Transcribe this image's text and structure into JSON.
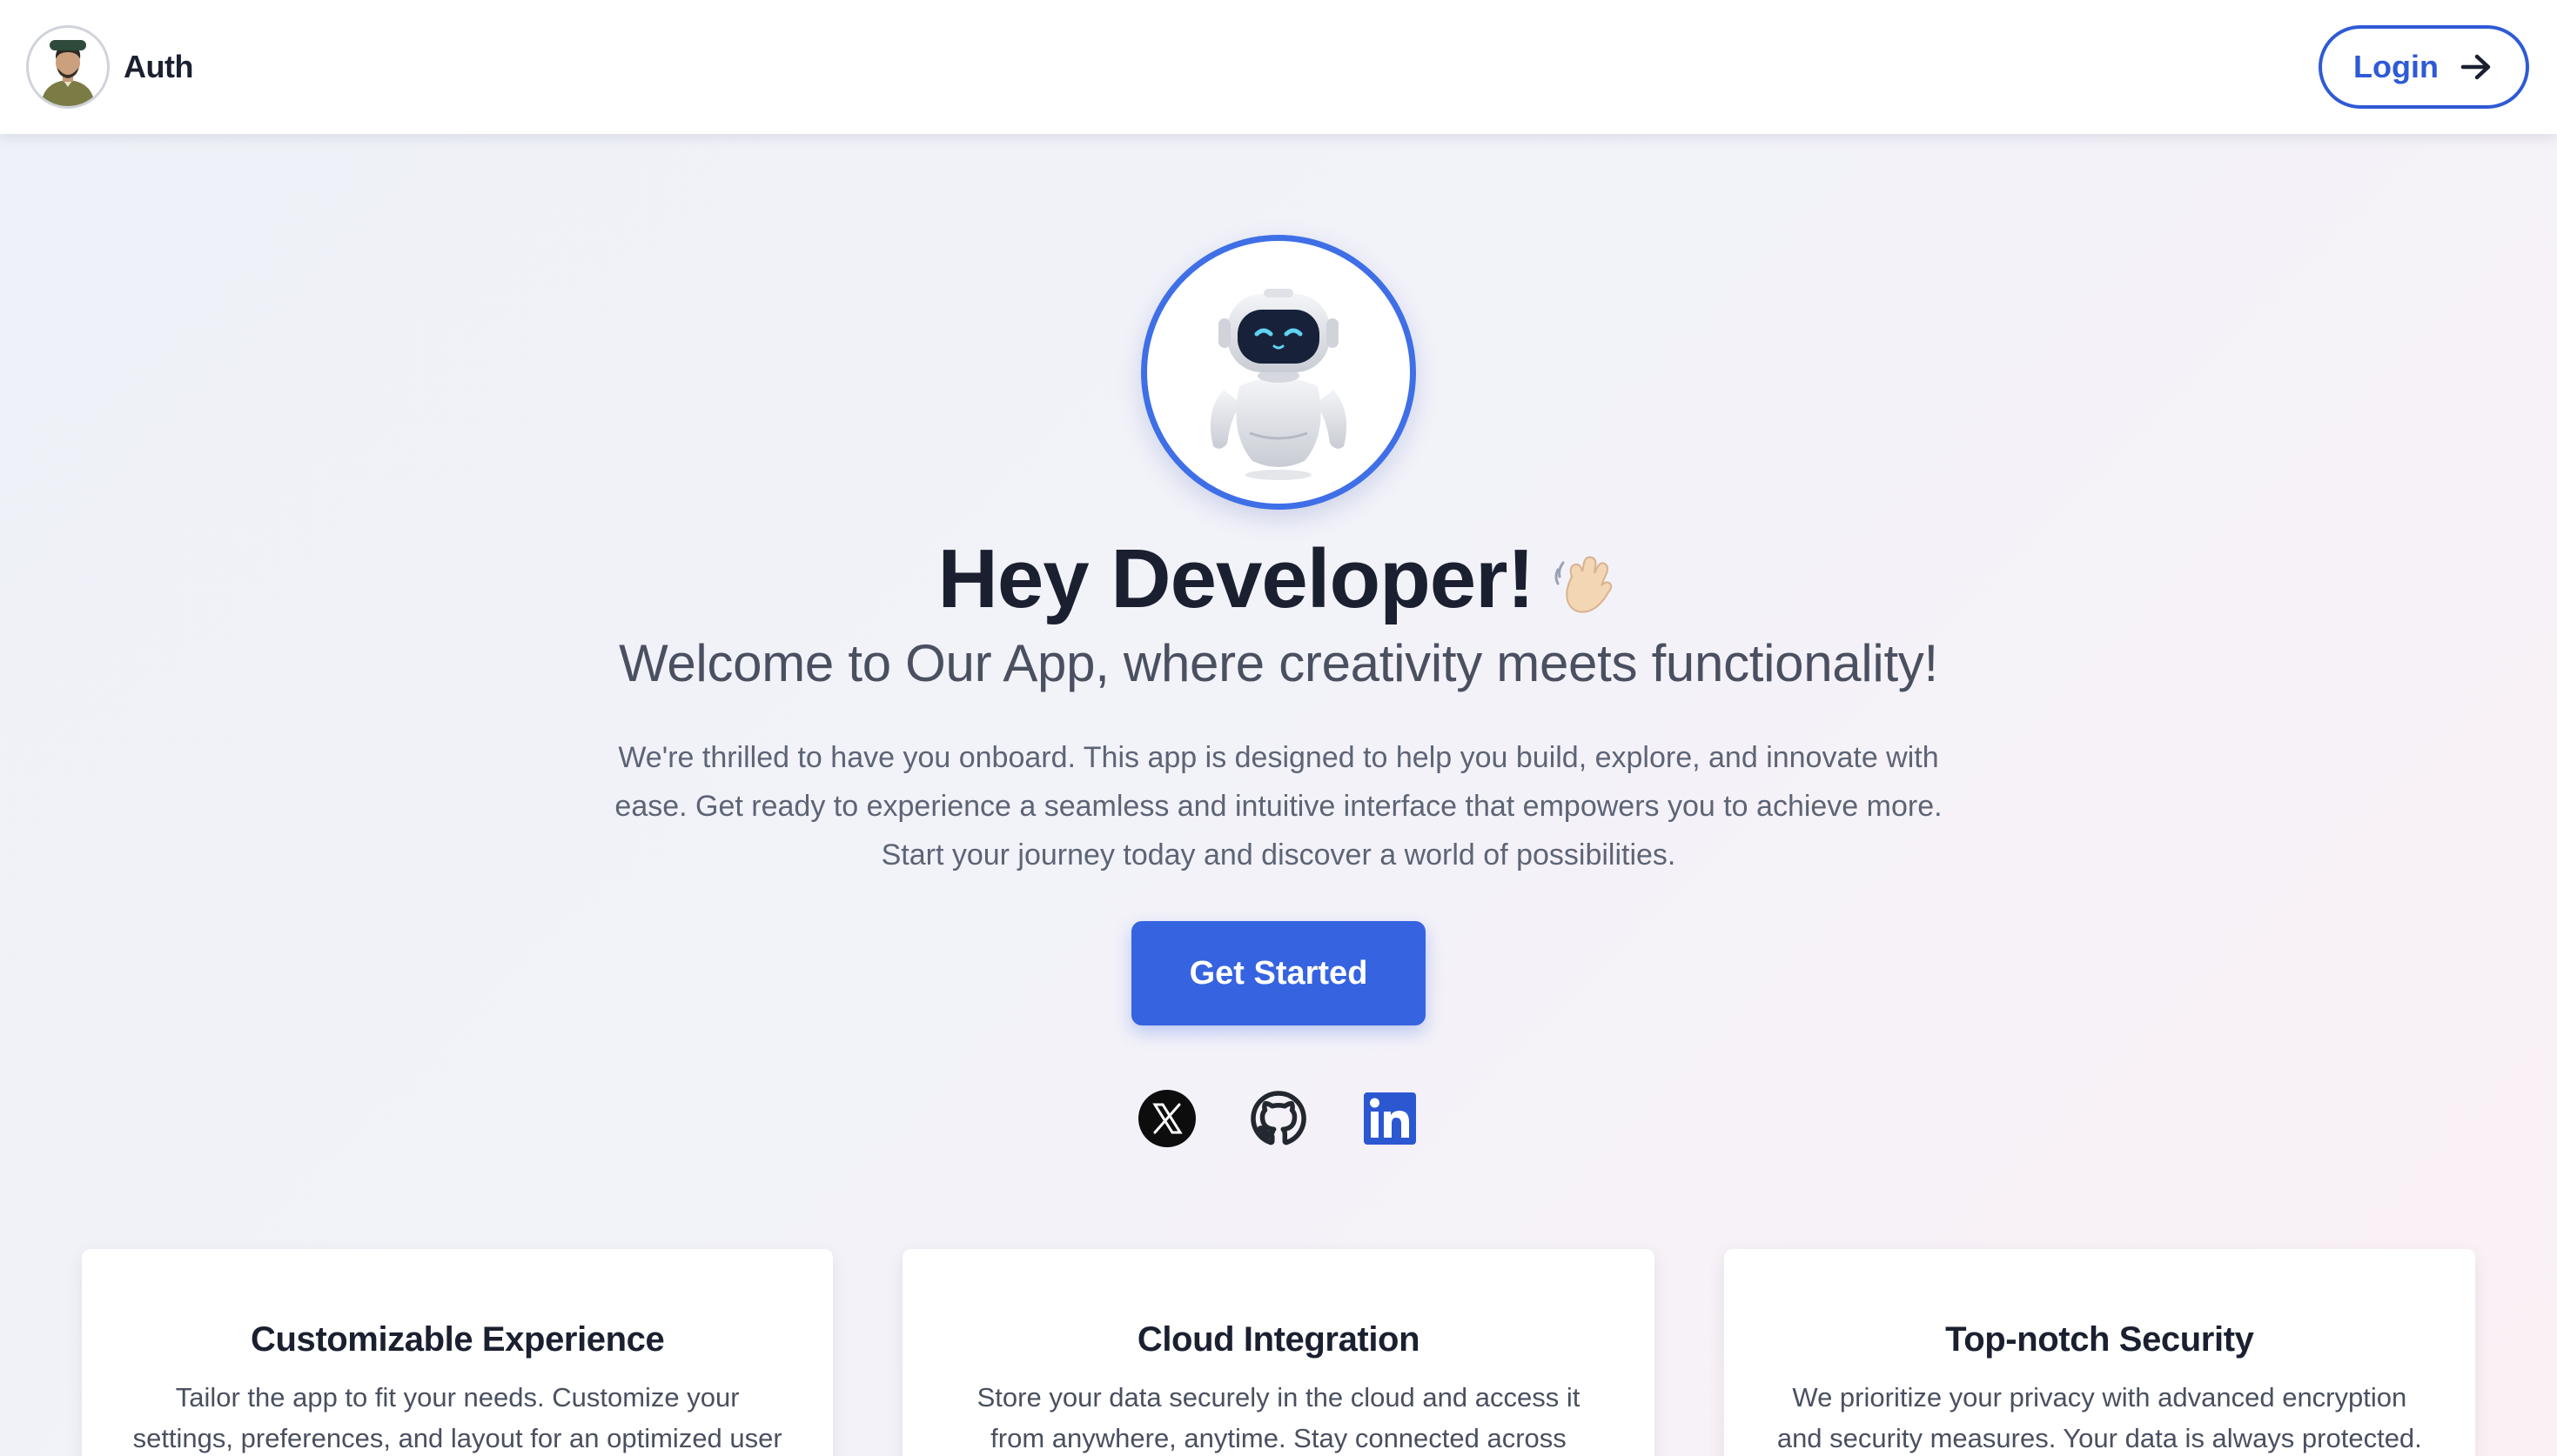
{
  "header": {
    "brand_name": "Auth",
    "avatar_icon": "user-avatar-icon",
    "login_label": "Login",
    "login_icon": "arrow-right-icon",
    "accent": "#2f5ad6"
  },
  "hero": {
    "robot_icon": "robot-mascot-icon",
    "headline": "Hey Developer!",
    "wave_icon": "waving-hand-icon",
    "subheadline": "Welcome to Our App, where creativity meets functionality!",
    "description": "We're thrilled to have you onboard. This app is designed to help you build, explore, and innovate with ease. Get ready to experience a seamless and intuitive interface that empowers you to achieve more. Start your journey today and discover a world of possibilities.",
    "cta_label": "Get Started",
    "cta_color": "#3663e0"
  },
  "socials": [
    {
      "name": "x-twitter-icon"
    },
    {
      "name": "github-icon"
    },
    {
      "name": "linkedin-icon"
    }
  ],
  "features": [
    {
      "title": "Customizable Experience",
      "text": "Tailor the app to fit your needs. Customize your settings, preferences, and layout for an optimized user"
    },
    {
      "title": "Cloud Integration",
      "text": "Store your data securely in the cloud and access it from anywhere, anytime. Stay connected across"
    },
    {
      "title": "Top-notch Security",
      "text": "We prioritize your privacy with advanced encryption and security measures. Your data is always protected."
    }
  ]
}
